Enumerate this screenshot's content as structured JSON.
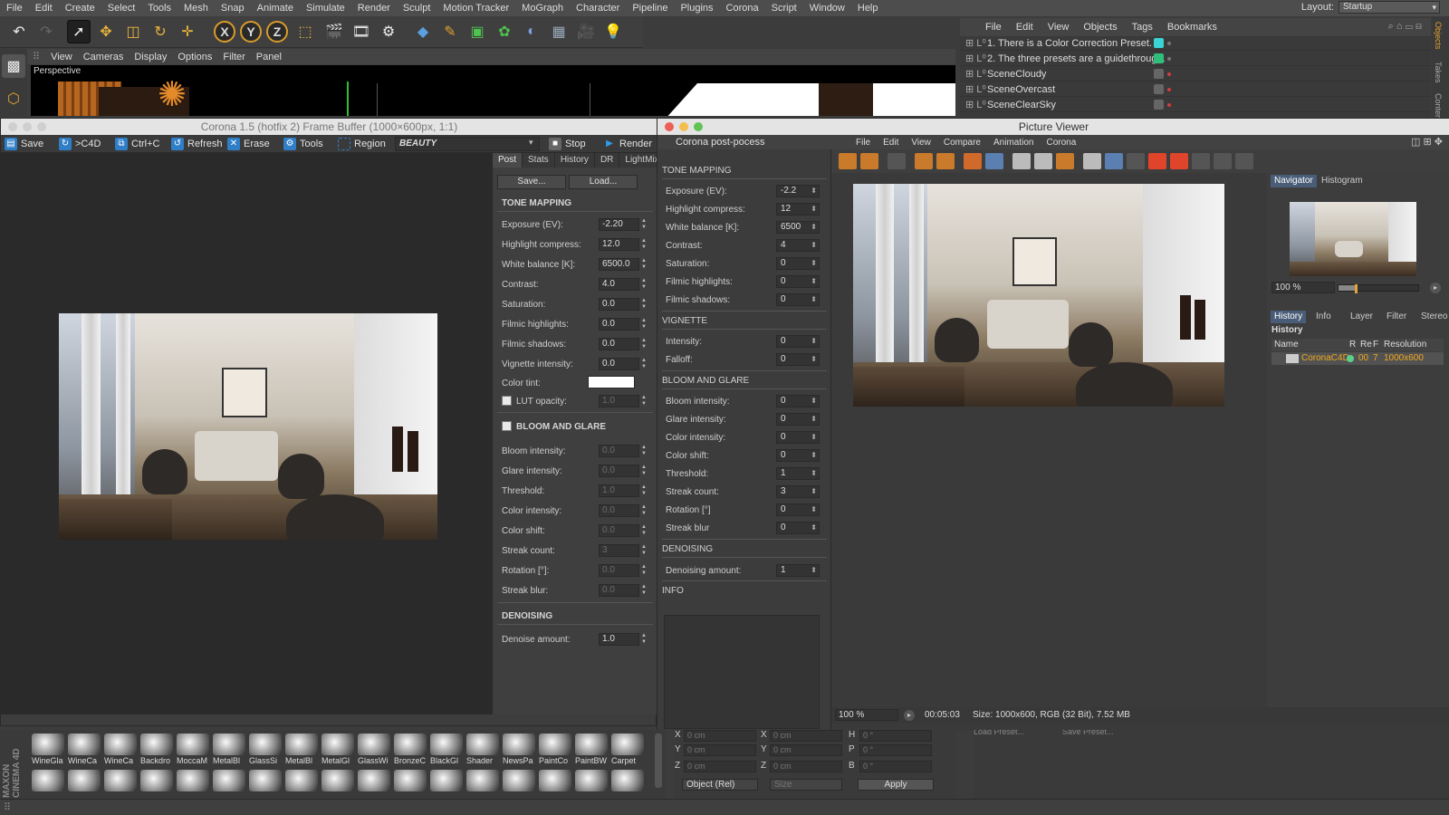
{
  "menubar": {
    "items": [
      "File",
      "Edit",
      "Create",
      "Select",
      "Tools",
      "Mesh",
      "Snap",
      "Animate",
      "Simulate",
      "Render",
      "Sculpt",
      "Motion Tracker",
      "MoGraph",
      "Character",
      "Pipeline",
      "Plugins",
      "Corona",
      "Script",
      "Window",
      "Help"
    ],
    "layout_label": "Layout:",
    "layout_value": "Startup"
  },
  "viewport": {
    "menu": [
      "View",
      "Cameras",
      "Display",
      "Options",
      "Filter",
      "Panel"
    ],
    "label": "Perspective"
  },
  "object_manager": {
    "menu": [
      "File",
      "Edit",
      "View",
      "Objects",
      "Tags",
      "Bookmarks"
    ],
    "rows": [
      {
        "name": "1.  There is a Color Correction Preset.",
        "tag": "#3ad4d4",
        "dot": "#777777"
      },
      {
        "name": "2.  The three presets are a guidethrough.",
        "tag": "#2fbf7a",
        "dot": "#777777"
      },
      {
        "name": "SceneCloudy",
        "tag": "#666666",
        "dot": "#d33c3c"
      },
      {
        "name": "SceneOvercast",
        "tag": "#666666",
        "dot": "#d33c3c"
      },
      {
        "name": "SceneClearSky",
        "tag": "#666666",
        "dot": "#d33c3c"
      }
    ],
    "side_tabs": [
      "Objects",
      "Takes",
      "Content"
    ]
  },
  "frame_buffer": {
    "title": "Corona 1.5 (hotfix 2) Frame Buffer (1000×600px, 1:1)",
    "toolbar": {
      "save": "Save",
      "to_c4d": ">C4D",
      "ctrl_c": "Ctrl+C",
      "refresh": "Refresh",
      "erase": "Erase",
      "tools": "Tools",
      "region": "Region",
      "channel": "BEAUTY",
      "stop": "Stop",
      "render": "Render"
    },
    "tabs": [
      "Post",
      "Stats",
      "History",
      "DR",
      "LightMix"
    ],
    "save_btn": "Save...",
    "load_btn": "Load...",
    "tone_mapping": "TONE MAPPING",
    "fields": [
      {
        "label": "Exposure (EV):",
        "value": "-2.20"
      },
      {
        "label": "Highlight compress:",
        "value": "12.0"
      },
      {
        "label": "White balance [K]:",
        "value": "6500.0"
      },
      {
        "label": "Contrast:",
        "value": "4.0"
      },
      {
        "label": "Saturation:",
        "value": "0.0"
      },
      {
        "label": "Filmic highlights:",
        "value": "0.0"
      },
      {
        "label": "Filmic shadows:",
        "value": "0.0"
      },
      {
        "label": "Vignette intensity:",
        "value": "0.0"
      }
    ],
    "color_tint": "Color tint:",
    "lut_opacity": {
      "label": "LUT opacity:",
      "value": "1.0"
    },
    "bloom_glare": "BLOOM AND GLARE",
    "bloom_fields": [
      {
        "label": "Bloom intensity:",
        "value": "0.0"
      },
      {
        "label": "Glare intensity:",
        "value": "0.0"
      },
      {
        "label": "Threshold:",
        "value": "1.0"
      },
      {
        "label": "Color intensity:",
        "value": "0.0"
      },
      {
        "label": "Color shift:",
        "value": "0.0"
      },
      {
        "label": "Streak count:",
        "value": "3"
      },
      {
        "label": "Rotation [°]:",
        "value": "0.0"
      },
      {
        "label": "Streak blur:",
        "value": "0.0"
      }
    ],
    "denoising": "DENOISING",
    "denoise": {
      "label": "Denoise amount:",
      "value": "1.0"
    }
  },
  "picture_viewer": {
    "title": "Picture Viewer",
    "post": {
      "header": "Corona post-pocess",
      "tone_mapping": "TONE MAPPING",
      "tone_fields": [
        {
          "label": "Exposure (EV):",
          "value": "-2.2"
        },
        {
          "label": "Highlight compress:",
          "value": "12"
        },
        {
          "label": "White balance [K]:",
          "value": "6500"
        },
        {
          "label": "Contrast:",
          "value": "4"
        },
        {
          "label": "Saturation:",
          "value": "0"
        },
        {
          "label": "Filmic highlights:",
          "value": "0"
        },
        {
          "label": "Filmic shadows:",
          "value": "0"
        }
      ],
      "vignette": "VIGNETTE",
      "vignette_fields": [
        {
          "label": "Intensity:",
          "value": "0"
        },
        {
          "label": "Falloff:",
          "value": "0"
        }
      ],
      "bloom": "BLOOM AND GLARE",
      "bloom_fields": [
        {
          "label": "Bloom intensity:",
          "value": "0"
        },
        {
          "label": "Glare intensity:",
          "value": "0"
        },
        {
          "label": "Color intensity:",
          "value": "0"
        },
        {
          "label": "Color shift:",
          "value": "0"
        },
        {
          "label": "Threshold:",
          "value": "1"
        },
        {
          "label": "Streak count:",
          "value": "3"
        },
        {
          "label": "Rotation [°]",
          "value": "0"
        },
        {
          "label": "Streak blur",
          "value": "0"
        }
      ],
      "denoising": "DENOISING",
      "denoise": {
        "label": "Denoising amount:",
        "value": "1"
      },
      "info": "INFO"
    },
    "menu": [
      "File",
      "Edit",
      "View",
      "Compare",
      "Animation",
      "Corona"
    ],
    "navigator_tabs": [
      "Navigator",
      "Histogram"
    ],
    "zoom": "100 %",
    "zoom_fraction": 0.2,
    "info_tabs": [
      "History",
      "Info",
      "Layer",
      "Filter",
      "Stereo"
    ],
    "history_title": "History",
    "history_cols": [
      "Name",
      "R",
      "Re",
      "F",
      "Resolution"
    ],
    "history_row": {
      "name": "CoronaC4D",
      "r": "00",
      "f": "7",
      "res": "1000x600"
    },
    "status": {
      "zoom": "100 %",
      "time": "00:05:03",
      "size": "Size: 1000x600, RGB (32 Bit), 7.52 MB"
    }
  },
  "materials": {
    "brand": "MAXON CINEMA 4D",
    "names": [
      "WineGla",
      "WineCa",
      "WineCa",
      "Backdro",
      "MoccaM",
      "MetalBl",
      "GlassSi",
      "MetalBl",
      "MetalGl",
      "GlassWi",
      "BronzeC",
      "BlackGl",
      "Shader",
      "NewsPa",
      "PaintCo",
      "PaintBW",
      "Carpet"
    ]
  },
  "coords": {
    "rows": [
      {
        "k1": "X",
        "v1": "0 cm",
        "k2": "X",
        "v2": "0 cm",
        "k3": "H",
        "v3": "0 °"
      },
      {
        "k1": "Y",
        "v1": "0 cm",
        "k2": "Y",
        "v2": "0 cm",
        "k3": "P",
        "v3": "0 °"
      },
      {
        "k1": "Z",
        "v1": "0 cm",
        "k2": "Z",
        "v2": "0 cm",
        "k3": "B",
        "v3": "0 °"
      }
    ],
    "mode": "Object (Rel)",
    "size": "Size",
    "apply": "Apply",
    "load_preset": "Load Preset...",
    "save_preset": "Save Preset..."
  }
}
